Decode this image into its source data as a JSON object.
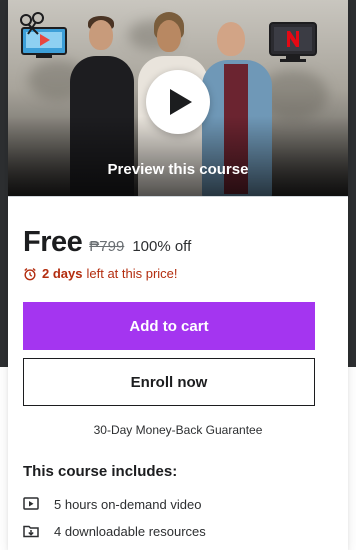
{
  "preview": {
    "label": "Preview this course",
    "badge_left_icon": "video-editing-icon",
    "badge_right_icon": "netflix-tv-icon"
  },
  "pricing": {
    "current": "Free",
    "original": "₱799",
    "discount": "100% off"
  },
  "timer": {
    "icon": "alarm-clock-icon",
    "bold": "2 days",
    "rest": "left at this price!"
  },
  "actions": {
    "add_to_cart": "Add to cart",
    "enroll_now": "Enroll now"
  },
  "guarantee": "30-Day Money-Back Guarantee",
  "includes": {
    "title": "This course includes:",
    "items": [
      {
        "icon": "video-icon",
        "label": "5 hours on-demand video"
      },
      {
        "icon": "download-folder-icon",
        "label": "4 downloadable resources"
      }
    ]
  },
  "colors": {
    "accent": "#a435f0",
    "timer_red": "#b32d0f",
    "text": "#1c1d1f",
    "page_dark": "#2d2f31"
  }
}
